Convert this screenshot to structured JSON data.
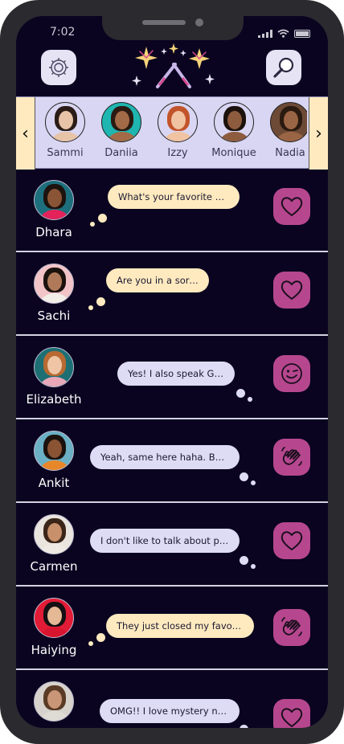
{
  "status": {
    "time": "7:02"
  },
  "header": {
    "settings_icon": "gear-icon",
    "search_icon": "magnifier-icon",
    "logo_icon": "sparkler-logo-icon"
  },
  "carousel": {
    "prev_icon": "chevron-left-icon",
    "next_icon": "chevron-right-icon",
    "prev_label": "‹",
    "next_label": "›",
    "profiles": [
      {
        "name": "Sammi",
        "skin": "#e7c3a8",
        "hair": "#2a1c16",
        "bg": "#d9d6f3"
      },
      {
        "name": "Daniia",
        "skin": "#a26a46",
        "hair": "#2a1a12",
        "bg": "#1fb5b0"
      },
      {
        "name": "Izzy",
        "skin": "#f0c3a2",
        "hair": "#c2542b",
        "bg": "#d9d6f3"
      },
      {
        "name": "Monique",
        "skin": "#8d5b3e",
        "hair": "#1c120c",
        "bg": "#d9d6f3"
      },
      {
        "name": "Nadia",
        "skin": "#9a6545",
        "hair": "#2a1a10",
        "bg": "#6d4a36"
      }
    ]
  },
  "feed": [
    {
      "name": "Dhara",
      "message": "What's your favorite movie?",
      "bubble": "cream",
      "side": "right",
      "reaction": "heart-icon",
      "skin": "#8a5536",
      "hair": "#1d130e",
      "shirt": "#e4235b",
      "bg": "#1d6f7d"
    },
    {
      "name": "Sachi",
      "message": "Are you in a sorority?",
      "bubble": "cream",
      "side": "right",
      "reaction": "heart-icon",
      "skin": "#b07a5a",
      "hair": "#1b120d",
      "shirt": "#f3eee8",
      "bg": "#f2c4c8"
    },
    {
      "name": "Elizabeth",
      "message": "Yes! I also speak German",
      "bubble": "lav",
      "side": "left",
      "reaction": "wink-icon",
      "skin": "#efc5a5",
      "hair": "#b86a32",
      "shirt": "#e9a8b8",
      "bg": "#1d6f74"
    },
    {
      "name": "Ankit",
      "message": "Yeah, same here haha.  But I…",
      "bubble": "lav",
      "side": "left",
      "reaction": "wave-icon",
      "skin": "#8a5334",
      "hair": "#1b120d",
      "shirt": "#e8862a",
      "bg": "#6bb0c4"
    },
    {
      "name": "Carmen",
      "message": "I don't like to talk about polit…",
      "bubble": "lav",
      "side": "left",
      "reaction": "heart-icon",
      "skin": "#c9906c",
      "hair": "#3a2518",
      "shirt": "#efe9e3",
      "bg": "#e9e4de"
    },
    {
      "name": "Haiying",
      "message": "They just closed my favorite r…",
      "bubble": "cream",
      "side": "right",
      "reaction": "wave-icon",
      "skin": "#e5b996",
      "hair": "#151013",
      "shirt": "#d8152f",
      "bg": "#e21b36"
    },
    {
      "name": "",
      "message": "OMG!! I love mystery novels!!",
      "bubble": "lav",
      "side": "left",
      "reaction": "heart-icon",
      "skin": "#c99677",
      "hair": "#5a3b25",
      "shirt": "#dedad4",
      "bg": "#d7d2cc"
    }
  ],
  "colors": {
    "screen_bg": "#0a0420",
    "accent": "#b6478e",
    "cream": "#ffeac0",
    "lavender": "#dedcf4"
  }
}
